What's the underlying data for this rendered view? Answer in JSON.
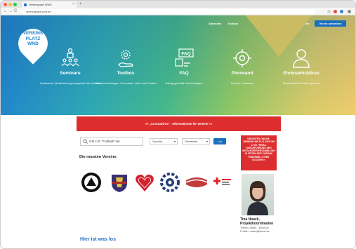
{
  "browser": {
    "tab_title": "Vereinsplatz WND",
    "new_tab": "+",
    "url": "vereinsplatz-wnd.de",
    "nav": {
      "back": "←",
      "forward": "→",
      "reload": "C"
    }
  },
  "topnav": {
    "item1": "Startseite",
    "item2": "Toolbox",
    "item3": "Vereine",
    "login": "Verein anmelden"
  },
  "logo": {
    "line1": "VEREINS",
    "line2": "PLATZ",
    "line3": "WND"
  },
  "services": [
    {
      "title": "Seminare",
      "desc": "Kostenlose Qualifizierungs-angebote für Vereine",
      "icon": "people-podium-icon"
    },
    {
      "title": "Toolbox",
      "desc": "Seminarunterlagen, Formulare, Infos zum Projekt",
      "icon": "gear-hand-icon"
    },
    {
      "title": "FAQ",
      "desc": "Häufig gestellte Vereinsfragen",
      "icon": "faq-icon"
    },
    {
      "title": "Pinnwand",
      "desc": "Suchen / Anbieten",
      "icon": "target-icon"
    },
    {
      "title": "Ehrenamtsbörse",
      "desc": "Ehrenamtliche Helfer gesucht",
      "icon": "person-icon"
    }
  ],
  "banner": {
    "text": ">> „Coronavirus\" - Informationen für Vereine <<"
  },
  "search": {
    "placeholder": "Gib z.B. \"Fußball\" ein",
    "select1": "Sportart",
    "select2": "Gemeinde",
    "button": "Los"
  },
  "newest": {
    "heading": "Die neusten Vereine:"
  },
  "side_box": {
    "text": "NÄCHSTES ONLINE-SEMINAR AM 20.11.2020 UM 17:00 THEMA: DURCHFÜHRUNG DER MITGLIEDERVERSAMMLUNG IN ZEITEN DER CORONA PANDEMIE >>HIER KLICKEN<<"
  },
  "contact": {
    "name": "Tina Noack,",
    "role": "Projektkoordination",
    "phone": "Telefon: 06851 - 8019100",
    "email": "E-Mail: t.noack@lkwnd.de"
  },
  "footer": {
    "heading": "Hier ist was los"
  },
  "colors": {
    "accent": "#1a6fbf",
    "banner_red": "#dc2e2e"
  }
}
